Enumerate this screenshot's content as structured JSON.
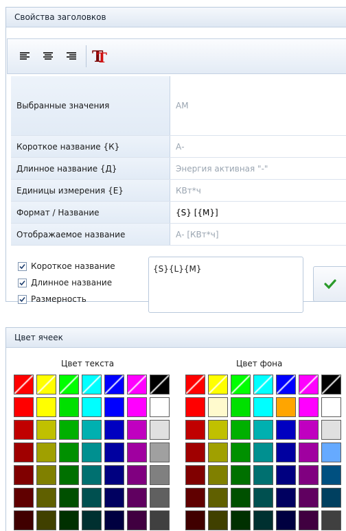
{
  "header_props": {
    "title": "Свойства заголовков"
  },
  "toolbar": {
    "icons": [
      "align-left-icon",
      "align-center-icon",
      "align-right-icon",
      "font-style-icon"
    ]
  },
  "props": [
    {
      "label": "Выбранные значения",
      "value": "АМ",
      "active": false
    },
    {
      "label": "Короткое название {К}",
      "value": "А-",
      "active": false
    },
    {
      "label": "Длинное название {Д}",
      "value": "Энергия активная \"-\"",
      "active": false
    },
    {
      "label": "Единицы измерения {Е}",
      "value": "КВт*ч",
      "active": false
    },
    {
      "label": "Формат / Название",
      "value": "{S} [{M}]",
      "active": true
    },
    {
      "label": "Отображаемое название",
      "value": "А- [КВт*ч]",
      "active": false
    }
  ],
  "checks": [
    {
      "label": "Короткое название",
      "checked": true
    },
    {
      "label": "Длинное название",
      "checked": true
    },
    {
      "label": "Размерность",
      "checked": true
    }
  ],
  "format_text": "{S}{L}{M}",
  "header_colors": {
    "title": "Цвет ячеек"
  },
  "text_color": {
    "title": "Цвет текста",
    "rows": [
      [
        "#ff0000",
        "#ffff00",
        "#00ff00",
        "#00ffff",
        "#0000ff",
        "#ff00ff",
        "#000000"
      ],
      [
        "#ff0000",
        "#ffff00",
        "#00e000",
        "#00ffff",
        "#0000ff",
        "#ff00ff",
        "#ffffff"
      ],
      [
        "#c00000",
        "#c0c000",
        "#00b000",
        "#00b0b0",
        "#0000c0",
        "#c000c0",
        "#e0e0e0"
      ],
      [
        "#a00000",
        "#a0a000",
        "#009000",
        "#009090",
        "#0000a0",
        "#a000a0",
        "#a0a0a0"
      ],
      [
        "#800000",
        "#808000",
        "#007000",
        "#007070",
        "#000080",
        "#800080",
        "#808080"
      ],
      [
        "#600000",
        "#606000",
        "#005000",
        "#005050",
        "#000060",
        "#600060",
        "#606060"
      ],
      [
        "#400000",
        "#404000",
        "#003000",
        "#003030",
        "#000040",
        "#400040",
        "#404040"
      ]
    ]
  },
  "bg_color": {
    "title": "Цвет фона",
    "rows": [
      [
        "#ff0000",
        "#ffff00",
        "#00ff00",
        "#00ffff",
        "#0000ff",
        "#ff00ff",
        "#000000"
      ],
      [
        "#ff0000",
        "#fffacd",
        "#00e000",
        "#00ffff",
        "#ffa500",
        "#ff00ff",
        "#ffffff"
      ],
      [
        "#c00000",
        "#c0c000",
        "#00b000",
        "#00b0b0",
        "#0000c0",
        "#c000c0",
        "#e0e0e0"
      ],
      [
        "#a00000",
        "#a0a000",
        "#009000",
        "#009090",
        "#0000a0",
        "#a000a0",
        "#66aaff"
      ],
      [
        "#800000",
        "#808000",
        "#007000",
        "#007070",
        "#000080",
        "#800080",
        "#005080"
      ],
      [
        "#600000",
        "#606000",
        "#005000",
        "#005050",
        "#000060",
        "#600060",
        "#004060"
      ],
      [
        "#400000",
        "#404000",
        "#003000",
        "#003030",
        "#000040",
        "#400040",
        "#404040"
      ]
    ]
  },
  "colors": {
    "accent": "#2a9a2a",
    "header_bg": "#dfe8f3",
    "label_bg": "#e2ebf6"
  }
}
